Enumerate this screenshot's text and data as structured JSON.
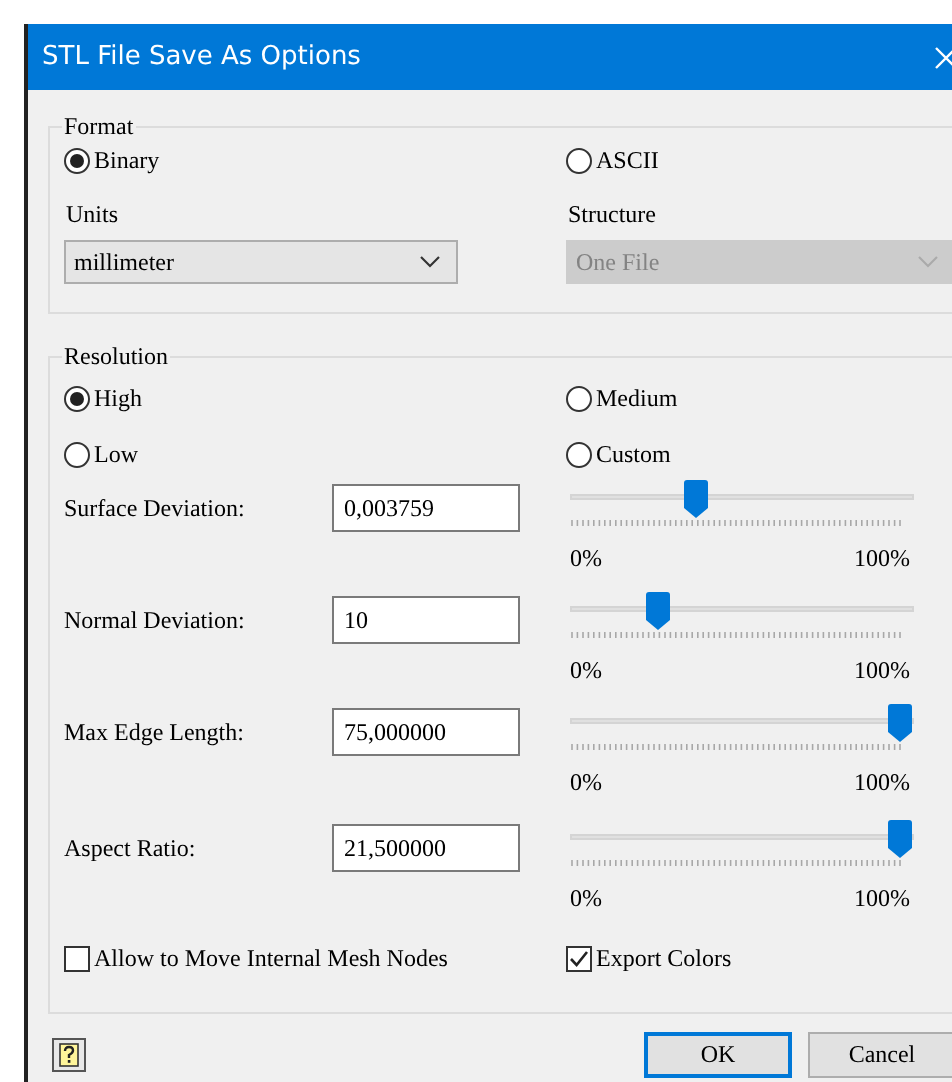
{
  "window": {
    "title": "STL File Save As Options"
  },
  "format": {
    "label": "Format",
    "options": [
      {
        "label": "Binary",
        "selected": true
      },
      {
        "label": "ASCII",
        "selected": false
      }
    ],
    "units": {
      "label": "Units",
      "value": "millimeter",
      "disabled": false
    },
    "structure": {
      "label": "Structure",
      "value": "One File",
      "disabled": true
    }
  },
  "resolution": {
    "label": "Resolution",
    "options": [
      {
        "label": "High",
        "selected": true
      },
      {
        "label": "Medium",
        "selected": false
      },
      {
        "label": "Low",
        "selected": false
      },
      {
        "label": "Custom",
        "selected": false
      }
    ],
    "parameters": [
      {
        "label": "Surface Deviation:",
        "value": "0,003759",
        "level": 0.36,
        "min_label": "0%",
        "max_label": "100%"
      },
      {
        "label": "Normal Deviation:",
        "value": "10",
        "level": 0.24,
        "min_label": "0%",
        "max_label": "100%"
      },
      {
        "label": "Max Edge Length:",
        "value": "75,000000",
        "level": 1,
        "min_label": "0%",
        "max_label": "100%"
      },
      {
        "label": "Aspect Ratio:",
        "value": "21,500000",
        "level": 1,
        "min_label": "0%",
        "max_label": "100%"
      }
    ]
  },
  "checkboxes": [
    {
      "label": "Allow to Move Internal Mesh Nodes",
      "checked": false
    },
    {
      "label": "Export Colors",
      "checked": true
    }
  ],
  "buttons": [
    {
      "label": "OK",
      "default": true
    },
    {
      "label": "Cancel",
      "default": false
    }
  ]
}
